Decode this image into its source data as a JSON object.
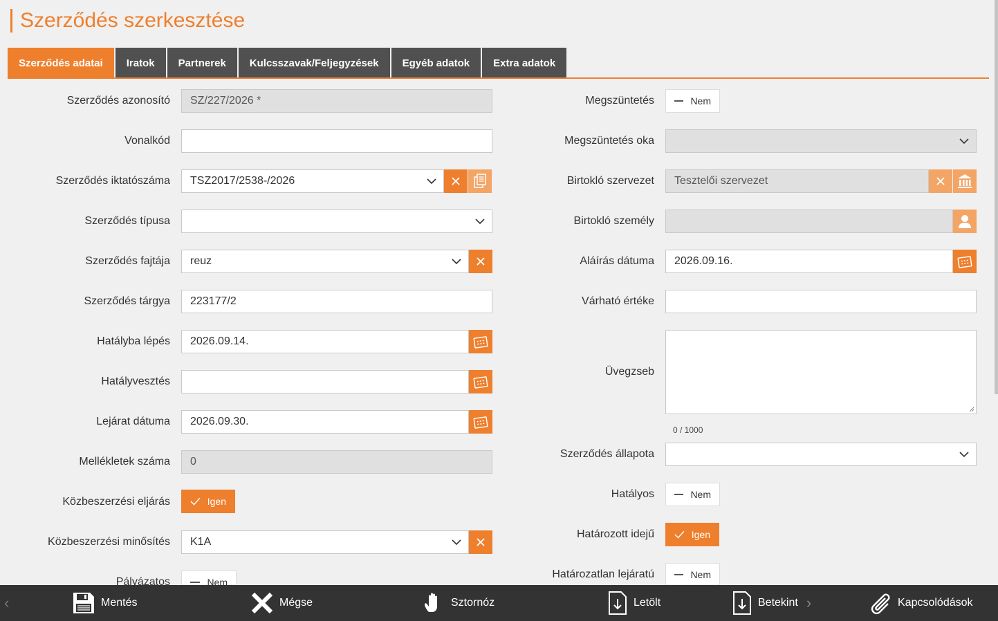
{
  "page": {
    "title": "Szerződés szerkesztése"
  },
  "tabs": [
    {
      "label": "Szerződés adatai"
    },
    {
      "label": "Iratok"
    },
    {
      "label": "Partnerek"
    },
    {
      "label": "Kulcsszavak/Feljegyzések"
    },
    {
      "label": "Egyéb adatok"
    },
    {
      "label": "Extra adatok"
    }
  ],
  "left": {
    "azonosito": {
      "label": "Szerződés azonosító",
      "value": "SZ/227/2026  *"
    },
    "vonalkod": {
      "label": "Vonalkód",
      "value": ""
    },
    "iktatoszam": {
      "label": "Szerződés iktatószáma",
      "value": "TSZ2017/2538-/2026"
    },
    "tipus": {
      "label": "Szerződés típusa",
      "value": ""
    },
    "fajta": {
      "label": "Szerződés fajtája",
      "value": "reuz"
    },
    "targy": {
      "label": "Szerződés tárgya",
      "value": "223177/2"
    },
    "hatalyba": {
      "label": "Hatályba lépés",
      "value": "2026.09.14."
    },
    "hatalyvesztes": {
      "label": "Hatályvesztés",
      "value": ""
    },
    "lejarat": {
      "label": "Lejárat dátuma",
      "value": "2026.09.30."
    },
    "mellekletek": {
      "label": "Mellékletek száma",
      "value": "0"
    },
    "kozbeszerzesi_eljaras": {
      "label": "Közbeszerzési eljárás",
      "toggle": "Igen"
    },
    "kozbeszerzesi_minosites": {
      "label": "Közbeszerzési minősítés",
      "value": "K1A"
    },
    "palyazatos": {
      "label": "Pályázatos",
      "toggle": "Nem"
    }
  },
  "right": {
    "megszuntetes": {
      "label": "Megszüntetés",
      "toggle": "Nem"
    },
    "megszuntetes_oka": {
      "label": "Megszüntetés oka",
      "value": ""
    },
    "birtoklo_szervezet": {
      "label": "Birtokló szervezet",
      "value": "Tesztelői szervezet"
    },
    "birtoklo_szemely": {
      "label": "Birtokló személy",
      "value": ""
    },
    "alairas": {
      "label": "Aláírás dátuma",
      "value": "2026.09.16."
    },
    "vart_ertek": {
      "label": "Várható értéke",
      "value": ""
    },
    "uvegzseb": {
      "label": "Üvegzseb",
      "value": "",
      "counter": "0 / 1000"
    },
    "allapot": {
      "label": "Szerződés állapota",
      "value": ""
    },
    "hatalyos": {
      "label": "Hatályos",
      "toggle": "Nem"
    },
    "hatarozott": {
      "label": "Határozott idejű",
      "toggle": "Igen"
    },
    "hatarozatlan": {
      "label": "Határozatlan lejáratú",
      "toggle": "Nem"
    }
  },
  "bottom": {
    "mentes": "Mentés",
    "megse": "Mégse",
    "sztornoz": "Sztornóz",
    "letolt": "Letölt",
    "betekint": "Betekint",
    "kapcsolodasok": "Kapcsolódások"
  },
  "colors": {
    "accent": "#ee7f2d",
    "tab_inactive": "#505050",
    "bottombar": "#333333"
  }
}
